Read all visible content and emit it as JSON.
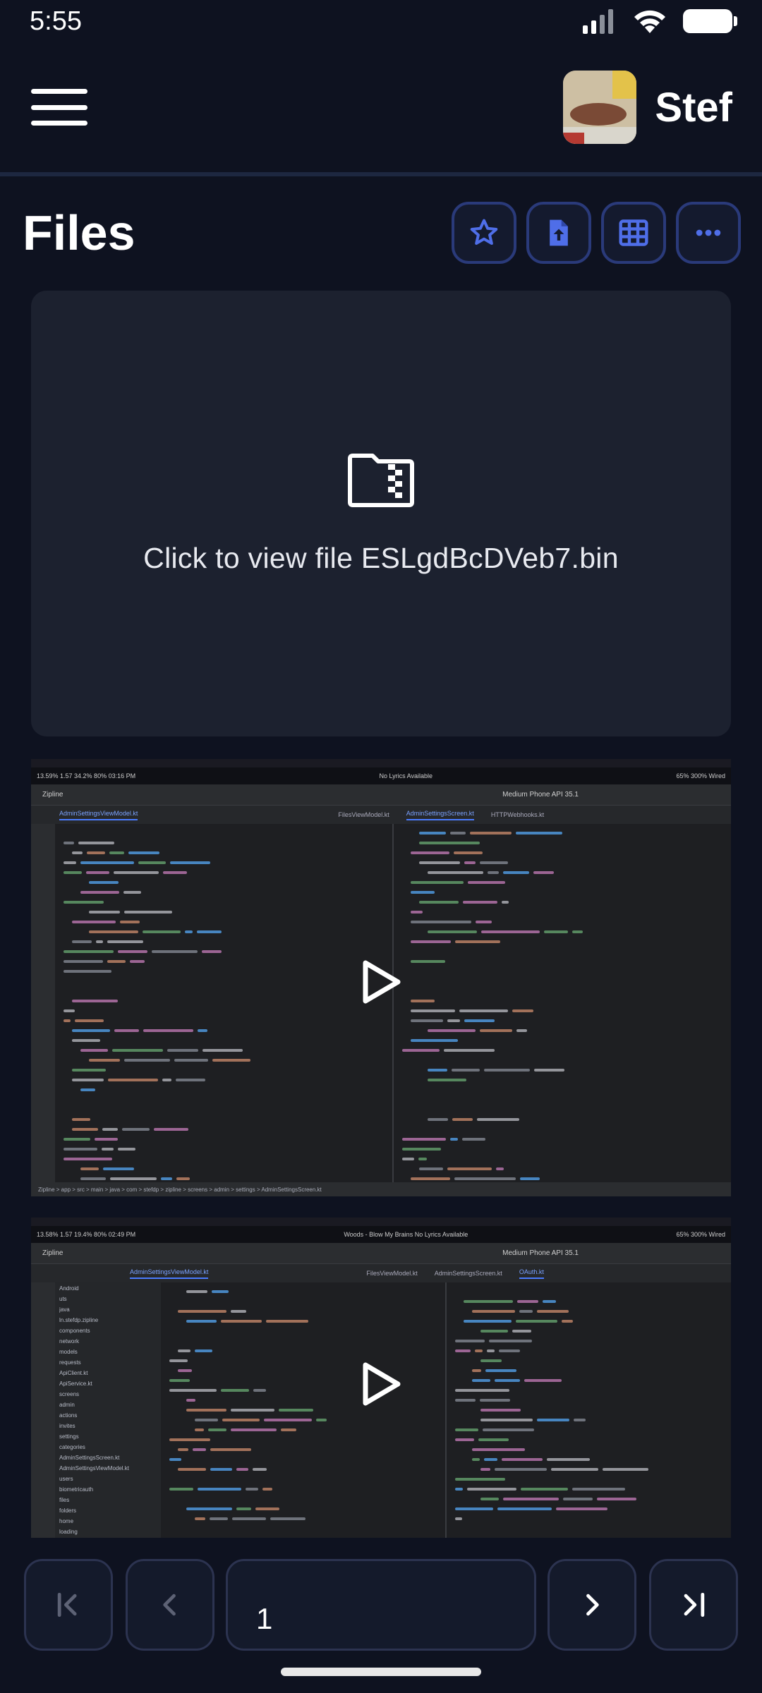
{
  "status": {
    "time": "5:55"
  },
  "user": {
    "name": "Stef"
  },
  "page": {
    "title": "Files"
  },
  "card": {
    "text": "Click to view file ESLgdBcDVeb7.bin"
  },
  "thumbs": [
    {
      "top_left": "13.59%  1.57  34.2%  80%  03:16 PM",
      "top_center": "No Lyrics Available",
      "top_right": "65%  300%  Wired",
      "project": "Zipline",
      "device": "Medium Phone API 35.1",
      "tabs": [
        "AdminSettingsViewModel.kt",
        "FilesViewModel.kt",
        "AdminSettingsScreen.kt",
        "HTTPWebhooks.kt"
      ],
      "status": "Zipline > app > src > main > java > com > stefdp > zipline > screens > admin > settings > AdminSettingsScreen.kt"
    },
    {
      "top_left": "13.58%  1.57  19.4%  80%  02:49 PM",
      "top_center": "Woods - Blow My Brains  No Lyrics Available",
      "top_right": "65%  300%  Wired",
      "project": "Zipline",
      "device": "Medium Phone API 35.1",
      "tabs": [
        "AdminSettingsViewModel.kt",
        "FilesViewModel.kt",
        "AdminSettingsScreen.kt",
        "OAuth.kt"
      ],
      "tree": [
        "Android",
        "uts",
        "java",
        "ln.stefdp.zipline",
        "components",
        "network",
        "models",
        "requests",
        "ApiClient.kt",
        "ApiService.kt",
        "screens",
        "admin",
        "actions",
        "invites",
        "settings",
        "categories",
        "AdminSettingsScreen.kt",
        "AdminSettingsViewModel.kt",
        "users",
        "biometricauth",
        "files",
        "folders",
        "home",
        "loading"
      ]
    }
  ],
  "pager": {
    "page_value": "1"
  }
}
